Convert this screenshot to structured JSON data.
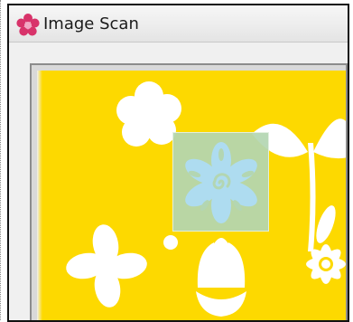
{
  "window": {
    "title": "Image Scan"
  },
  "icons": {
    "app": "pink-flower-icon",
    "selection": "blue-flower-icon"
  },
  "colors": {
    "image_background": "#fdd900",
    "flower_white": "#ffffff",
    "selection_fill": "#b3d6b2",
    "selection_flower": "#aedcf0",
    "app_icon": "#d8336a"
  }
}
